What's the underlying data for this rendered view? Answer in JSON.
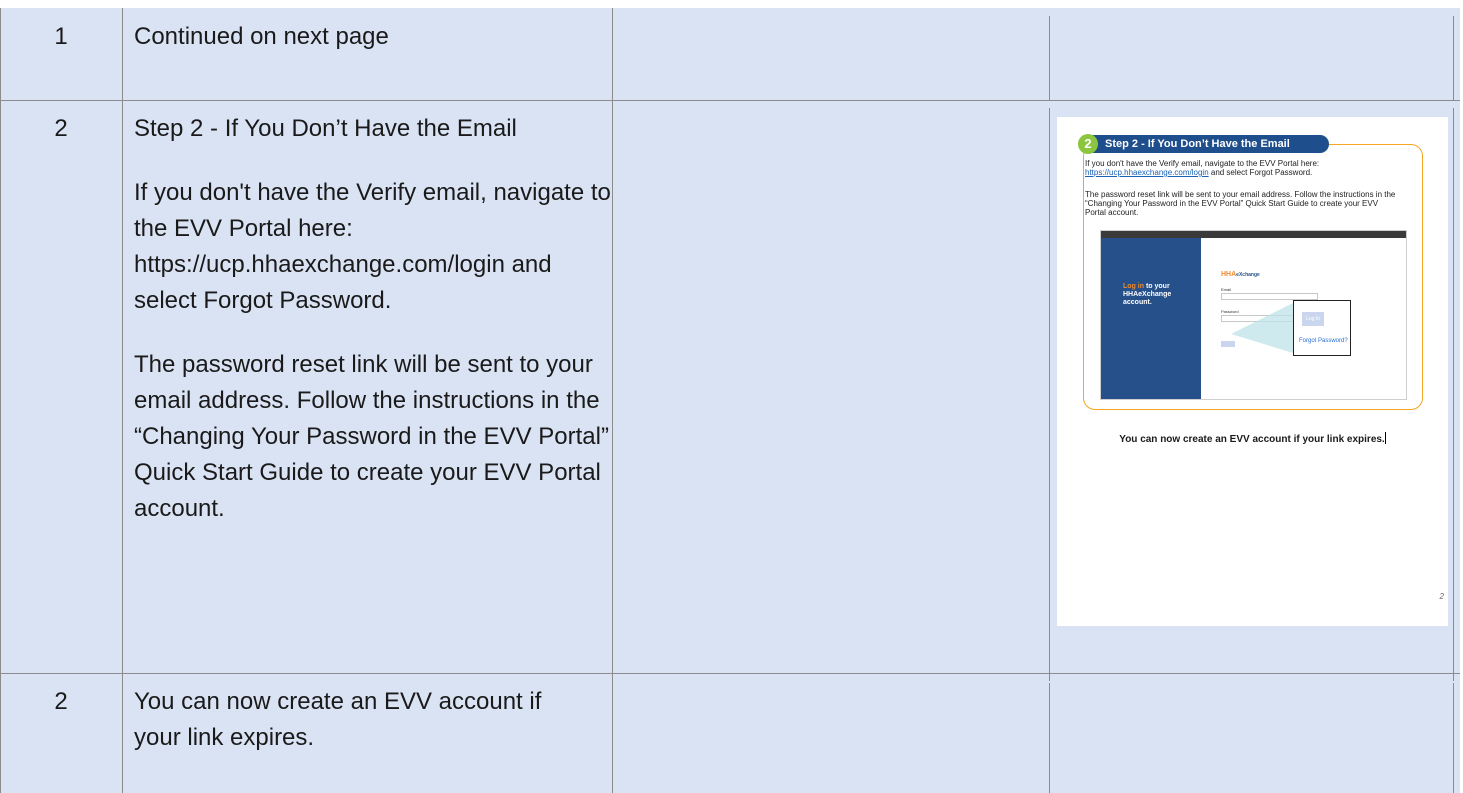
{
  "rows": [
    {
      "number": "1",
      "paragraphs": [
        "Continued on next page"
      ]
    },
    {
      "number": "2",
      "paragraphs": [
        "Step 2 - If You Don’t Have the Email",
        "If you don't have the Verify email, navigate to the EVV Portal here: https://ucp.hhaexchange.com/login and select Forgot Password.",
        "The password reset link will be sent to your email address. Follow the instructions in the “Changing Your Password in the EVV Portal” Quick Start Guide to create your EVV Portal account."
      ]
    },
    {
      "number": "2",
      "paragraphs": [
        "You can now create an EVV account if your link expires."
      ]
    }
  ],
  "thumbnail": {
    "badge": "2",
    "title": "Step 2 - If You Don’t Have the Email",
    "para1_text": "If you don't have the Verify email, navigate to the EVV Portal here:",
    "para1_link": "https://ucp.hhaexchange.com/login",
    "para1_end": " and select Forgot Password.",
    "para2": "The password reset link will be sent to your email address. Follow the instructions in the “Changing Your Password in the EVV Portal” Quick Start Guide to create your EVV Portal account.",
    "screenshot": {
      "login_highlight": "Log in",
      "login_rest1": " to your",
      "login_rest2": "HHAeXchange",
      "login_rest3": "account.",
      "brand_main": "HHA",
      "brand_sub": "eXchange",
      "email_label": "Email",
      "password_label": "Password",
      "zoom_button": "Log In",
      "zoom_link": "Forgot Password?"
    },
    "footer_line": "You can now create an EVV account if your link expires.",
    "page_number": "2"
  },
  "colors": {
    "cell_bg": "#dae3f3",
    "grid": "#8c8c8c",
    "accent_orange": "#f5a623",
    "title_blue": "#1f4e8c",
    "badge_green": "#8cc63f"
  }
}
